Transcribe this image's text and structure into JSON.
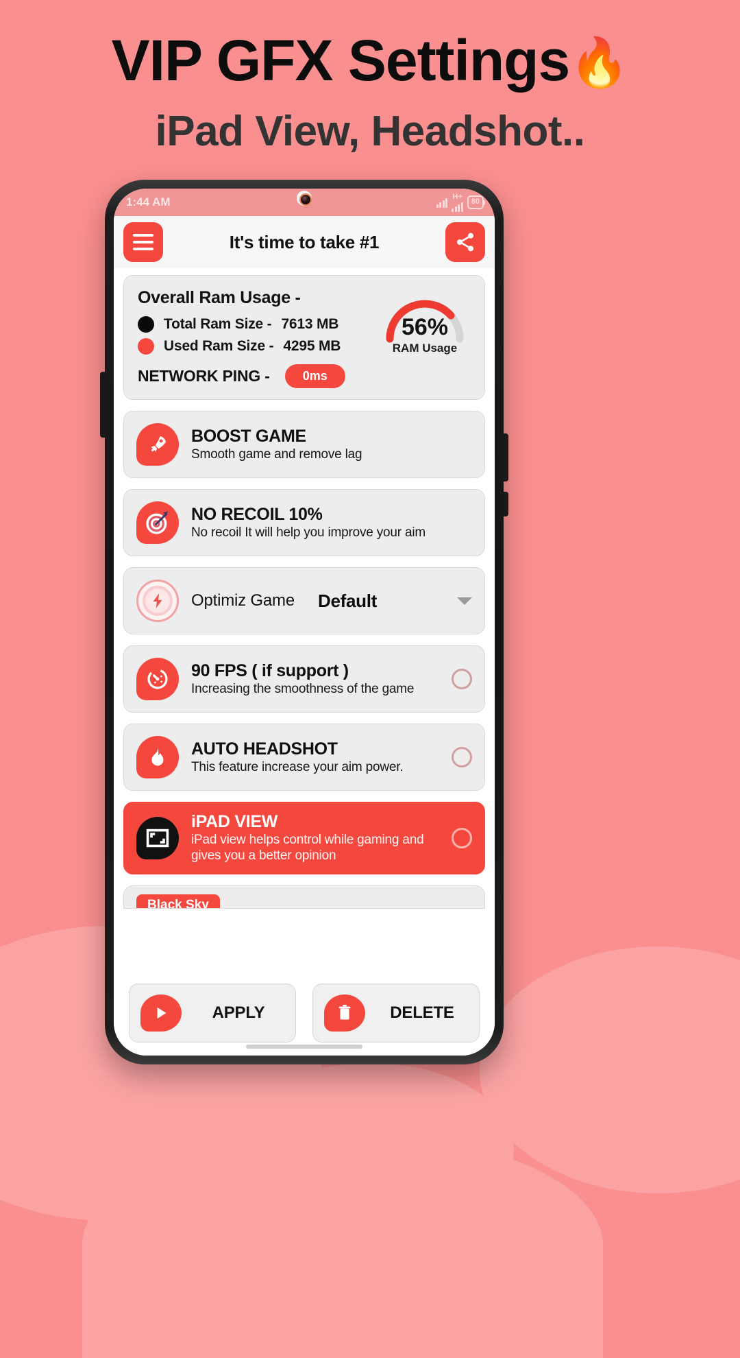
{
  "promo": {
    "title": "VIP GFX Settings",
    "title_emoji": "🔥",
    "subtitle": "iPad View, Headshot.."
  },
  "status_bar": {
    "time": "1:44 AM",
    "network_type": "H+",
    "battery_level": "80"
  },
  "appbar": {
    "menu_icon": "hamburger-icon",
    "title": "It's time to take #1",
    "share_icon": "share-icon"
  },
  "ram_card": {
    "heading": "Overall Ram Usage  -",
    "total_label": "Total Ram Size -",
    "total_value": "7613 MB",
    "used_label": "Used Ram Size -",
    "used_value": "4295 MB",
    "gauge_percent": "56%",
    "gauge_caption": "RAM Usage",
    "gauge_value": 56,
    "ping_label": "NETWORK PING -",
    "ping_value": "0ms"
  },
  "features": [
    {
      "icon": "rocket-icon",
      "title": "BOOST GAME",
      "desc": "Smooth game and remove lag",
      "has_radio": false,
      "active": false
    },
    {
      "icon": "target-icon",
      "title": "NO RECOIL 10%",
      "desc": "No recoil It will help you improve your aim",
      "has_radio": false,
      "active": false
    }
  ],
  "optimiz": {
    "icon": "bolt-icon",
    "label": "Optimiz Game",
    "value": "Default",
    "caret": "chevron-down-icon"
  },
  "toggles": [
    {
      "icon": "speedometer-icon",
      "title": "90 FPS ( if support )",
      "desc": "Increasing the smoothness of the game",
      "active": false
    },
    {
      "icon": "flame-icon",
      "title": "AUTO HEADSHOT",
      "desc": "This feature increase your aim power.",
      "active": false
    },
    {
      "icon": "expand-icon",
      "title": "iPAD VIEW",
      "desc": "iPad view helps control while gaming and gives you a better opinion",
      "active": true
    }
  ],
  "peek": {
    "label": "Black Sky"
  },
  "bottom_bar": {
    "apply_icon": "play-icon",
    "apply_label": "APPLY",
    "delete_icon": "trash-icon",
    "delete_label": "DELETE"
  },
  "colors": {
    "brand_red": "#f4483f",
    "page_background": "#fa8f8f",
    "card_grey": "#ededed"
  }
}
